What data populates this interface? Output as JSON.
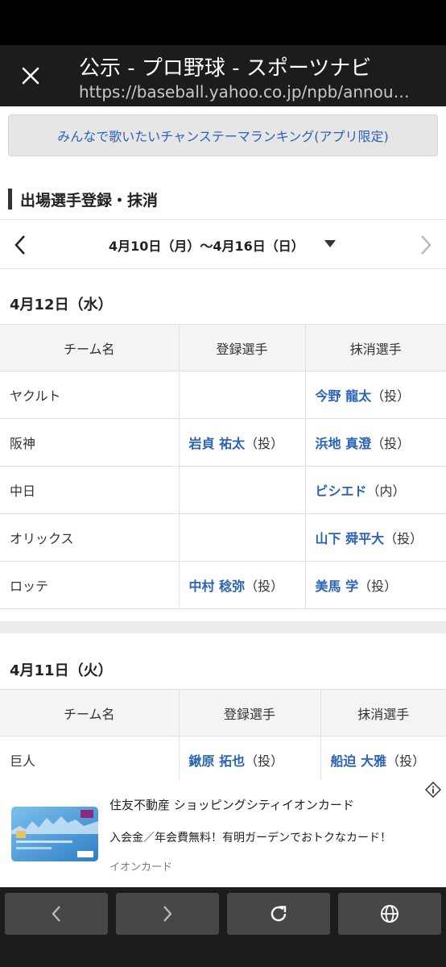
{
  "header": {
    "title": "公示 - プロ野球 - スポーツナビ",
    "url": "https://baseball.yahoo.co.jp/npb/announcement"
  },
  "promo_link": "みんなで歌いたいチャンステーマランキング(アプリ限定)",
  "section_title": "出場選手登録・抹消",
  "date_range": "4月10日（月）〜4月16日（日）",
  "columns": [
    "チーム名",
    "登録選手",
    "抹消選手"
  ],
  "days": [
    {
      "date": "4月12日（水）",
      "rows": [
        {
          "team": "ヤクルト",
          "reg_name": "",
          "reg_pos": "",
          "del_name": "今野 龍太",
          "del_pos": "（投）"
        },
        {
          "team": "阪神",
          "reg_name": "岩貞 祐太",
          "reg_pos": "（投）",
          "del_name": "浜地 真澄",
          "del_pos": "（投）"
        },
        {
          "team": "中日",
          "reg_name": "",
          "reg_pos": "",
          "del_name": "ビシエド",
          "del_pos": "（内）"
        },
        {
          "team": "オリックス",
          "reg_name": "",
          "reg_pos": "",
          "del_name": "山下 舜平大",
          "del_pos": "（投）"
        },
        {
          "team": "ロッテ",
          "reg_name": "中村 稔弥",
          "reg_pos": "（投）",
          "del_name": "美馬 学",
          "del_pos": "（投）"
        }
      ]
    },
    {
      "date": "4月11日（火）",
      "rows": [
        {
          "team": "巨人",
          "reg_name": "鍬原 拓也",
          "reg_pos": "（投）",
          "del_name": "船迫 大雅",
          "del_pos": "（投）"
        }
      ]
    }
  ],
  "ad": {
    "title": "住友不動産 ショッピングシティイオンカード",
    "body": "入会金／年会費無料！有明ガーデンでおトクなカード！",
    "source": "イオンカード"
  },
  "colors": {
    "link": "#2a63b6",
    "header_bg": "#1c1c1c",
    "table_header_bg": "#f4f4f4"
  }
}
